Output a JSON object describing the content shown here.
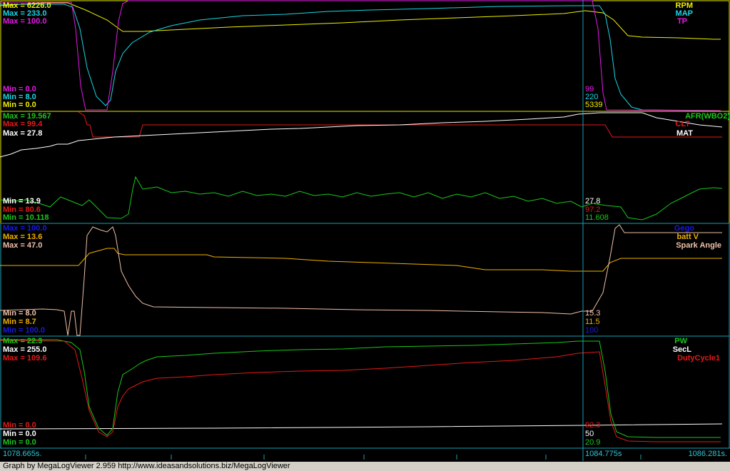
{
  "colors": {
    "rpm": "#f0f000",
    "map": "#19d7e6",
    "tp": "#e619e6",
    "afr": "#19c819",
    "clt": "#e61919",
    "mat": "#ffffff",
    "gego": "#1919e6",
    "batt": "#f0b000",
    "spark": "#f0c0a8",
    "pw": "#19c819",
    "secl": "#ffffff",
    "duty": "#e61919",
    "border1": "#e6e600",
    "border2": "#19a0b4",
    "cursor": "#19a0b4"
  },
  "panels": [
    {
      "series_labels": [
        "RPM",
        "MAP",
        "TP"
      ],
      "max_labels": [
        "Max = 6226.0",
        "Max = 233.0",
        "Max = 100.0"
      ],
      "min_labels": [
        "Min = 0.0",
        "Min = 8.0",
        "Min = 0.0"
      ],
      "cursor_values": [
        "99",
        "220",
        "5339"
      ]
    },
    {
      "series_labels": [
        "AFR(WBO2)",
        "CLT",
        "MAT"
      ],
      "max_labels": [
        "Max = 19.567",
        "Max = 99.4",
        "Max = 27.8"
      ],
      "min_labels": [
        "Min = 13.9",
        "Min = 80.6",
        "Min = 10.118"
      ],
      "cursor_values": [
        "27.8",
        "97.2",
        "11.608"
      ]
    },
    {
      "series_labels": [
        "Gego",
        "batt V",
        "Spark Angle"
      ],
      "max_labels": [
        "Max = 100.0",
        "Max = 13.6",
        "Max = 47.0"
      ],
      "min_labels": [
        "Min = 8.0",
        "Min = 8.7",
        "Min = 100.0"
      ],
      "cursor_values": [
        "15.3",
        "11.5",
        "100"
      ]
    },
    {
      "series_labels": [
        "PW",
        "SecL",
        "DutyCycle1"
      ],
      "max_labels": [
        "Max = 22.3",
        "Max = 255.0",
        "Max = 109.6"
      ],
      "min_labels": [
        "Min = 0.0",
        "Min = 0.0",
        "Min = 0.0"
      ],
      "cursor_values": [
        "92.3",
        "50",
        "20.9"
      ]
    }
  ],
  "time_axis": {
    "start": "1078.665s.",
    "cursor": "1084.775s",
    "end": "1086.281s."
  },
  "footer": "Graph by MegaLogViewer 2.959 http://www.ideasandsolutions.biz/MegaLogViewer"
}
